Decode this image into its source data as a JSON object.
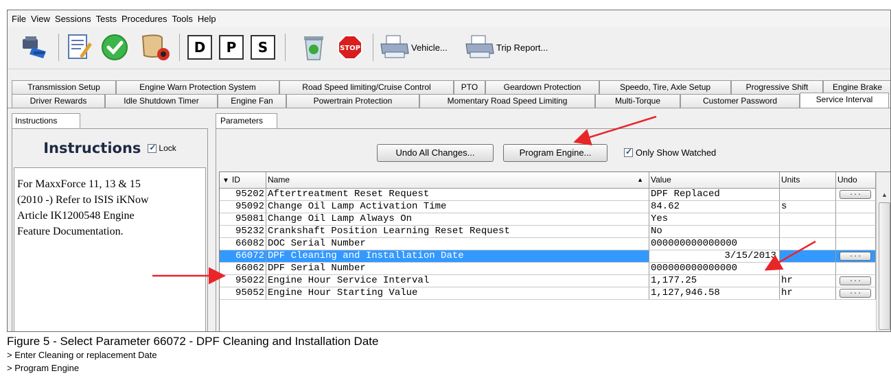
{
  "menu": [
    "File",
    "View",
    "Sessions",
    "Tests",
    "Procedures",
    "Tools",
    "Help"
  ],
  "toolbar": {
    "icons": [
      "connect-icon",
      "edit-icon",
      "check-icon",
      "scroll-icon",
      "d-icon",
      "p-icon",
      "s-icon",
      "recycle-bin-icon",
      "stop-icon",
      "printer-icon",
      "printer-icon"
    ],
    "d": "D",
    "p": "P",
    "s": "S",
    "stop": "STOP",
    "vehicle": "Vehicle...",
    "trip_report": "Trip Report..."
  },
  "tabs_row1": [
    "Transmission Setup",
    "Engine Warn Protection System",
    "Road Speed limiting/Cruise Control",
    "PTO",
    "Geardown Protection",
    "Speedo, Tire, Axle Setup",
    "Progressive Shift",
    "Engine Brake"
  ],
  "tabs_row2": [
    "Driver Rewards",
    "Idle Shutdown Timer",
    "Engine Fan",
    "Powertrain Protection",
    "Momentary Road Speed Limiting",
    "Multi-Torque",
    "Customer Password",
    "Service Interval"
  ],
  "left": {
    "tab": "Instructions",
    "title": "Instructions",
    "lock": "Lock",
    "body_lines": [
      "For MaxxForce 11, 13 & 15",
      "(2010 -) Refer to ISIS iKNow",
      "Article IK1200548 Engine",
      "Feature Documentation."
    ]
  },
  "params": {
    "tab": "Parameters",
    "undo_all": "Undo All Changes...",
    "program": "Program Engine...",
    "only_watched": "Only Show Watched",
    "headers": {
      "id": "ID",
      "name": "Name",
      "value": "Value",
      "units": "Units",
      "undo": "Undo"
    },
    "undo_button": "...",
    "rows": [
      {
        "id": "95202",
        "name": "Aftertreatment Reset Request",
        "value": "DPF Replaced",
        "units": "",
        "undo": true,
        "selected": false
      },
      {
        "id": "95092",
        "name": "Change Oil Lamp Activation Time",
        "value": "84.62",
        "units": "s",
        "undo": false,
        "selected": false
      },
      {
        "id": "95081",
        "name": "Change Oil Lamp Always On",
        "value": "Yes",
        "units": "",
        "undo": false,
        "selected": false
      },
      {
        "id": "95232",
        "name": "Crankshaft Position Learning Reset Request",
        "value": "No",
        "units": "",
        "undo": false,
        "selected": false
      },
      {
        "id": "66082",
        "name": "DOC Serial Number",
        "value": "000000000000000",
        "units": "",
        "undo": false,
        "selected": false
      },
      {
        "id": "66072",
        "name": "DPF Cleaning and Installation Date",
        "value": "3/15/2013",
        "units": "",
        "undo": true,
        "selected": true
      },
      {
        "id": "66062",
        "name": "DPF Serial Number",
        "value": "000000000000000",
        "units": "",
        "undo": false,
        "selected": false
      },
      {
        "id": "95022",
        "name": "Engine Hour Service Interval",
        "value": "1,177.25",
        "units": "hr",
        "undo": true,
        "selected": false
      },
      {
        "id": "95052",
        "name": "Engine Hour Starting Value",
        "value": "1,127,946.58",
        "units": "hr",
        "undo": true,
        "selected": false
      }
    ]
  },
  "caption": {
    "line1": "Figure 5 - Select Parameter 66072 - DPF Cleaning and Installation Date",
    "line2": "> Enter Cleaning or replacement Date",
    "line3": "> Program Engine"
  },
  "colors": {
    "selection": "#3399ff",
    "arrow": "#e8262a"
  }
}
